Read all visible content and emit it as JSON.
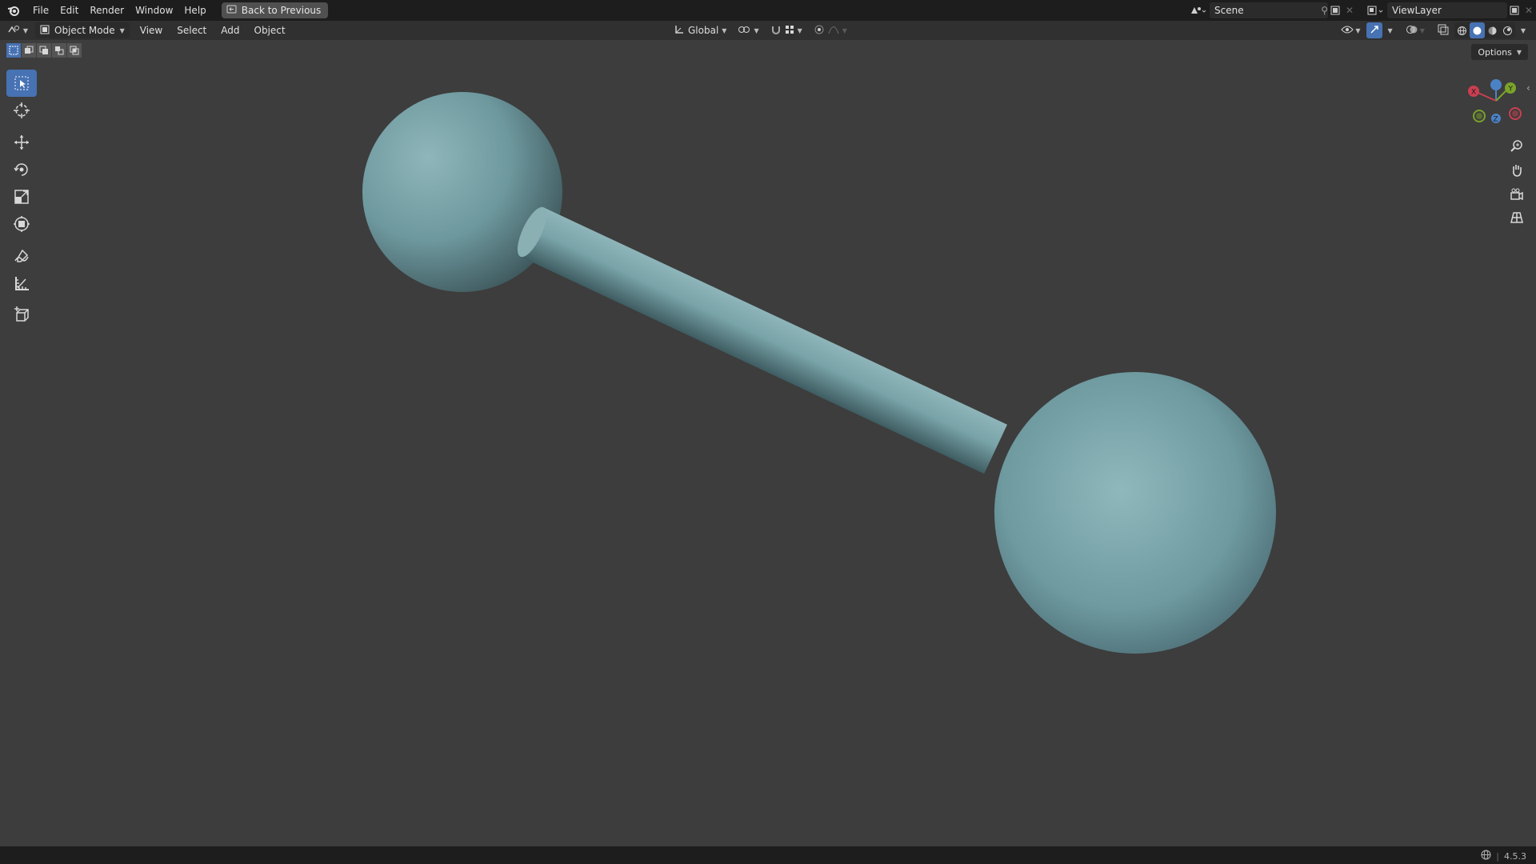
{
  "topbar": {
    "menus": [
      "File",
      "Edit",
      "Render",
      "Window",
      "Help"
    ],
    "back_button": "Back to Previous",
    "scene_name": "Scene",
    "view_layer_name": "ViewLayer"
  },
  "header": {
    "mode": "Object Mode",
    "menus": [
      "View",
      "Select",
      "Add",
      "Object"
    ],
    "orientation": "Global",
    "options_label": "Options"
  },
  "toolbar": {
    "tools": [
      "select-box",
      "cursor",
      "move",
      "rotate",
      "scale",
      "transform",
      "annotate",
      "measure",
      "add-cube"
    ],
    "active": "select-box"
  },
  "gizmo": {
    "axes": [
      "X",
      "Y",
      "Z"
    ]
  },
  "status": {
    "version": "4.5.3"
  },
  "colors": {
    "accent": "#4772b3",
    "object": "#6e9aa0",
    "background": "#3d3d3d"
  }
}
